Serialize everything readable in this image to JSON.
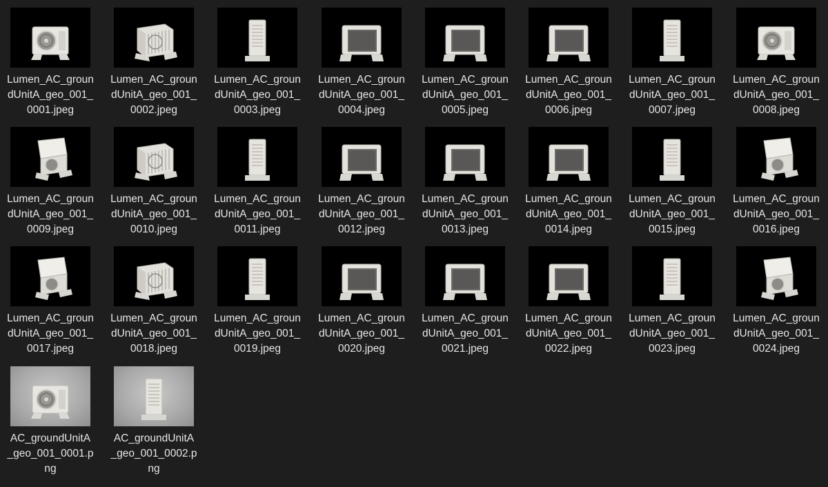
{
  "window": {
    "view": "Large icons"
  },
  "files": [
    {
      "name": "Lumen_AC_groundUnitA_geo_001_0001.jpeg",
      "label": "Lumen_AC_groun\ndUnitA_geo_001_\n0001.jpeg",
      "thumb": "ac-unit-front-fan",
      "bg": "black"
    },
    {
      "name": "Lumen_AC_groundUnitA_geo_001_0002.jpeg",
      "label": "Lumen_AC_groun\ndUnitA_geo_001_\n0002.jpeg",
      "thumb": "ac-unit-angled-grille",
      "bg": "black"
    },
    {
      "name": "Lumen_AC_groundUnitA_geo_001_0003.jpeg",
      "label": "Lumen_AC_groun\ndUnitA_geo_001_\n0003.jpeg",
      "thumb": "ac-unit-side-narrow",
      "bg": "black"
    },
    {
      "name": "Lumen_AC_groundUnitA_geo_001_0004.jpeg",
      "label": "Lumen_AC_groun\ndUnitA_geo_001_\n0004.jpeg",
      "thumb": "ac-unit-back-panel",
      "bg": "black"
    },
    {
      "name": "Lumen_AC_groundUnitA_geo_001_0005.jpeg",
      "label": "Lumen_AC_groun\ndUnitA_geo_001_\n0005.jpeg",
      "thumb": "ac-unit-back-angled",
      "bg": "black"
    },
    {
      "name": "Lumen_AC_groundUnitA_geo_001_0006.jpeg",
      "label": "Lumen_AC_groun\ndUnitA_geo_001_\n0006.jpeg",
      "thumb": "ac-unit-back-angled-2",
      "bg": "black"
    },
    {
      "name": "Lumen_AC_groundUnitA_geo_001_0007.jpeg",
      "label": "Lumen_AC_groun\ndUnitA_geo_001_\n0007.jpeg",
      "thumb": "ac-unit-side-narrow-2",
      "bg": "black"
    },
    {
      "name": "Lumen_AC_groundUnitA_geo_001_0008.jpeg",
      "label": "Lumen_AC_groun\ndUnitA_geo_001_\n0008.jpeg",
      "thumb": "ac-unit-front-angled",
      "bg": "black"
    },
    {
      "name": "Lumen_AC_groundUnitA_geo_001_0009.jpeg",
      "label": "Lumen_AC_groun\ndUnitA_geo_001_\n0009.jpeg",
      "thumb": "ac-unit-top-front",
      "bg": "black"
    },
    {
      "name": "Lumen_AC_groundUnitA_geo_001_0010.jpeg",
      "label": "Lumen_AC_groun\ndUnitA_geo_001_\n0010.jpeg",
      "thumb": "ac-unit-top-angled",
      "bg": "black"
    },
    {
      "name": "Lumen_AC_groundUnitA_geo_001_0011.jpeg",
      "label": "Lumen_AC_groun\ndUnitA_geo_001_\n0011.jpeg",
      "thumb": "ac-unit-top-side",
      "bg": "black"
    },
    {
      "name": "Lumen_AC_groundUnitA_geo_001_0012.jpeg",
      "label": "Lumen_AC_groun\ndUnitA_geo_001_\n0012.jpeg",
      "thumb": "ac-unit-top-back",
      "bg": "black"
    },
    {
      "name": "Lumen_AC_groundUnitA_geo_001_0013.jpeg",
      "label": "Lumen_AC_groun\ndUnitA_geo_001_\n0013.jpeg",
      "thumb": "ac-unit-top-back-2",
      "bg": "black"
    },
    {
      "name": "Lumen_AC_groundUnitA_geo_001_0014.jpeg",
      "label": "Lumen_AC_groun\ndUnitA_geo_001_\n0014.jpeg",
      "thumb": "ac-unit-top-back-angled",
      "bg": "black"
    },
    {
      "name": "Lumen_AC_groundUnitA_geo_001_0015.jpeg",
      "label": "Lumen_AC_groun\ndUnitA_geo_001_\n0015.jpeg",
      "thumb": "ac-unit-top-side-2",
      "bg": "black"
    },
    {
      "name": "Lumen_AC_groundUnitA_geo_001_0016.jpeg",
      "label": "Lumen_AC_groun\ndUnitA_geo_001_\n0016.jpeg",
      "thumb": "ac-unit-top-front-angled",
      "bg": "black"
    },
    {
      "name": "Lumen_AC_groundUnitA_geo_001_0017.jpeg",
      "label": "Lumen_AC_groun\ndUnitA_geo_001_\n0017.jpeg",
      "thumb": "ac-unit-high-front",
      "bg": "black"
    },
    {
      "name": "Lumen_AC_groundUnitA_geo_001_0018.jpeg",
      "label": "Lumen_AC_groun\ndUnitA_geo_001_\n0018.jpeg",
      "thumb": "ac-unit-high-angled",
      "bg": "black"
    },
    {
      "name": "Lumen_AC_groundUnitA_geo_001_0019.jpeg",
      "label": "Lumen_AC_groun\ndUnitA_geo_001_\n0019.jpeg",
      "thumb": "ac-unit-high-side",
      "bg": "black"
    },
    {
      "name": "Lumen_AC_groundUnitA_geo_001_0020.jpeg",
      "label": "Lumen_AC_groun\ndUnitA_geo_001_\n0020.jpeg",
      "thumb": "ac-unit-high-back-angled",
      "bg": "black"
    },
    {
      "name": "Lumen_AC_groundUnitA_geo_001_0021.jpeg",
      "label": "Lumen_AC_groun\ndUnitA_geo_001_\n0021.jpeg",
      "thumb": "ac-unit-high-back",
      "bg": "black"
    },
    {
      "name": "Lumen_AC_groundUnitA_geo_001_0022.jpeg",
      "label": "Lumen_AC_groun\ndUnitA_geo_001_\n0022.jpeg",
      "thumb": "ac-unit-high-back-angled-2",
      "bg": "black"
    },
    {
      "name": "Lumen_AC_groundUnitA_geo_001_0023.jpeg",
      "label": "Lumen_AC_groun\ndUnitA_geo_001_\n0023.jpeg",
      "thumb": "ac-unit-high-side-2",
      "bg": "black"
    },
    {
      "name": "Lumen_AC_groundUnitA_geo_001_0024.jpeg",
      "label": "Lumen_AC_groun\ndUnitA_geo_001_\n0024.jpeg",
      "thumb": "ac-unit-high-front-angled",
      "bg": "black"
    },
    {
      "name": "AC_groundUnitA_geo_001_0001.png",
      "label": "AC_groundUnitA\n_geo_001_0001.p\nng",
      "thumb": "ac-unit-studio-front",
      "bg": "gray"
    },
    {
      "name": "AC_groundUnitA_geo_001_0002.png",
      "label": "AC_groundUnitA\n_geo_001_0002.p\nng",
      "thumb": "ac-unit-studio-side",
      "bg": "gray"
    }
  ]
}
